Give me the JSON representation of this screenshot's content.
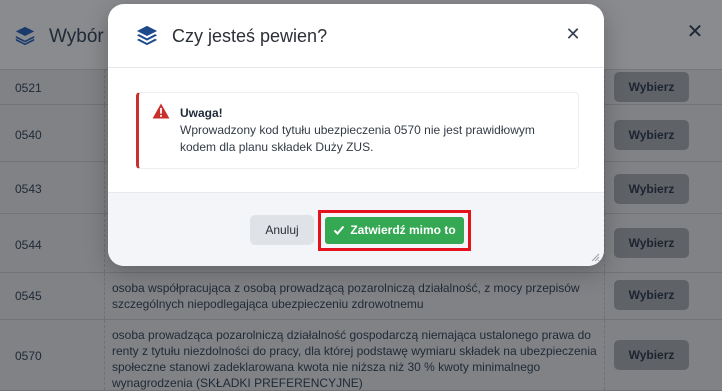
{
  "background": {
    "title": "Wybór k",
    "rows": [
      {
        "code": "0521",
        "desc": "",
        "button": "Wybierz"
      },
      {
        "code": "0540",
        "desc": "",
        "button": "Wybierz"
      },
      {
        "code": "0543",
        "desc": "",
        "button": "Wybierz"
      },
      {
        "code": "0544",
        "desc": "",
        "button": "Wybierz"
      },
      {
        "code": "0545",
        "desc": "osoba współpracująca z osobą prowadzącą pozarolniczą działalność, z mocy przepisów szczególnych niepodlegająca ubezpieczeniu zdrowotnemu",
        "button": "Wybierz"
      },
      {
        "code": "0570",
        "desc": "osoba prowadząca pozarolniczą działalność gospodarczą niemająca ustalonego prawa do renty z tytułu niezdolności do pracy, dla której podstawę wymiaru składek na ubezpieczenia społeczne stanowi zadeklarowana kwota nie niższa niż 30 % kwoty minimalnego wynagrodzenia (SKŁADKI PREFERENCYJNE)",
        "button": "Wybierz"
      }
    ]
  },
  "modal": {
    "title": "Czy jesteś pewien?",
    "alert": {
      "title": "Uwaga!",
      "message": "Wprowadzony kod tytułu ubezpieczenia 0570 nie jest prawidłowym kodem dla planu składek Duży ZUS."
    },
    "cancel_label": "Anuluj",
    "confirm_label": "Zatwierdź mimo to"
  },
  "colors": {
    "confirm": "#34a853",
    "highlight_border": "#e3121c",
    "alert_accent": "#c9302c"
  },
  "icons": [
    "layers-icon",
    "close-icon",
    "warning-icon",
    "check-icon",
    "resize-handle-icon"
  ]
}
